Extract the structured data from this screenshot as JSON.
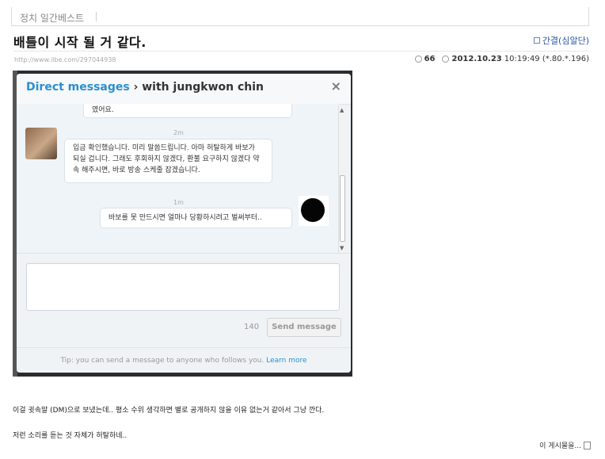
{
  "board": {
    "name": "정치 일간베스트"
  },
  "post": {
    "title": "배틀이 시작 될 거 같다.",
    "author": "간결(심알단)",
    "url": "http://www.ilbe.com/297044938",
    "comment_count": "66",
    "date": "2012.10.23",
    "time_ip": "10:19:49 (*.80.*.196)",
    "body_line1": "이걸 귓속말 (DM)으로 보냈는데.. 평소 수위 생각하면 별로 공개하지 않을 이유 없는거 같아서 그냥 깐다.",
    "body_line2": "저런 소리를 듣는 것 자체가 허탈하네..",
    "more_label": "이 게시물을..."
  },
  "dm_window": {
    "title_link": "Direct messages",
    "title_rest": " › with jungkwon chin",
    "close_glyph": "×",
    "messages": [
      {
        "text": "였어요."
      },
      {
        "time": "2m",
        "text": "입금 확인했습니다. 미리 말씀드립니다. 아마 허탈하게 바보가 되실 겁니다. 그래도 후회하지 않겠다, 환불 요구하지 않겠다 약속 해주시면, 바로 방송 스케줄 잡겠습니다."
      },
      {
        "time": "1m",
        "text": "바보를 못 만드시면 얼마나 당황하시려고 벌써부터.."
      }
    ],
    "char_count": "140",
    "send_label": "Send message",
    "tip_text": "Tip: you can send a message to anyone who follows you. ",
    "tip_link": "Learn more"
  },
  "colors": {
    "link_blue": "#2a8fd0",
    "author_blue": "#2a55a6"
  }
}
